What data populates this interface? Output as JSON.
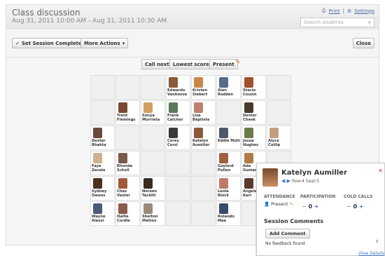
{
  "header": {
    "title": "Class discussion",
    "subtitle": "Aug 31, 2011 10:00 AM - Aug 31, 2011 10:30 AM",
    "print": "Print",
    "settings": "Settings",
    "search_placeholder": "Search students"
  },
  "toolbar": {
    "set_session_completed": "Set Session Completed",
    "more_actions": "More Actions",
    "close": "Close"
  },
  "grid_actions": {
    "call_next": "Call next",
    "lowest_scores": "Lowest scores",
    "present": "Present"
  },
  "seats": [
    {
      "row": 0,
      "col": 3,
      "name": "Edwardo Vanhoose",
      "color": "#8a5a3a"
    },
    {
      "row": 0,
      "col": 4,
      "name": "Kristen Siebert",
      "color": "#c9874a"
    },
    {
      "row": 0,
      "col": 5,
      "name": "Alan Rodden",
      "color": "#5a6a8a"
    },
    {
      "row": 0,
      "col": 6,
      "name": "Stacie Cousin",
      "color": "#a05030"
    },
    {
      "row": 1,
      "col": 1,
      "name": "Trent Flemings",
      "color": "#7a4a30"
    },
    {
      "row": 1,
      "col": 2,
      "name": "Sonya Murrieta",
      "color": "#d0a060"
    },
    {
      "row": 1,
      "col": 3,
      "name": "Frank Catcher",
      "color": "#5a7a5a"
    },
    {
      "row": 1,
      "col": 4,
      "name": "Lisa Baptiste",
      "color": "#c08070"
    },
    {
      "row": 1,
      "col": 6,
      "name": "Dexter Cheek",
      "color": "#4a3a2a"
    },
    {
      "row": 2,
      "col": 0,
      "name": "Dexter Bhakta",
      "color": "#6a4a3a"
    },
    {
      "row": 2,
      "col": 3,
      "name": "Corey Corsi",
      "color": "#3a3a3a"
    },
    {
      "row": 2,
      "col": 4,
      "name": "Katelyn Aumiller",
      "color": "#8a5a3a"
    },
    {
      "row": 2,
      "col": 5,
      "name": "Eddie Mott",
      "color": "#4a5a6a"
    },
    {
      "row": 2,
      "col": 6,
      "name": "Josue Hughes",
      "color": "#6a7a4a"
    },
    {
      "row": 2,
      "col": 7,
      "name": "Alyce Cutlip",
      "color": "#c0a080"
    },
    {
      "row": 3,
      "col": 0,
      "name": "Faye Zavala",
      "color": "#d0b090"
    },
    {
      "row": 3,
      "col": 1,
      "name": "Rhonda Scholl",
      "color": "#7a5a4a"
    },
    {
      "row": 3,
      "col": 5,
      "name": "Gaylord Pullen",
      "color": "#a06040"
    },
    {
      "row": 3,
      "col": 6,
      "name": "Ada Guman",
      "color": "#b07a4a"
    },
    {
      "row": 4,
      "col": 0,
      "name": "Sydney Owens",
      "color": "#4a3020"
    },
    {
      "row": 4,
      "col": 1,
      "name": "Chas Vester",
      "color": "#a05a3a"
    },
    {
      "row": 4,
      "col": 2,
      "name": "Noreen Tackitt",
      "color": "#3a2a20"
    },
    {
      "row": 4,
      "col": 5,
      "name": "Leola Block",
      "color": "#c07a6a"
    },
    {
      "row": 4,
      "col": 6,
      "name": "Angela Karr",
      "color": "#5a3a2a"
    },
    {
      "row": 5,
      "col": 0,
      "name": "Wayne Alessi",
      "color": "#4a5a7a"
    },
    {
      "row": 5,
      "col": 1,
      "name": "Hallie Cordle",
      "color": "#8a5a4a"
    },
    {
      "row": 5,
      "col": 2,
      "name": "Shelton Mattox",
      "color": "#9a8a7a"
    },
    {
      "row": 5,
      "col": 5,
      "name": "Rolando Mae",
      "color": "#3a4a6a"
    }
  ],
  "empty_cells": [
    [
      0,
      0
    ],
    [
      0,
      7
    ],
    [
      1,
      0
    ],
    [
      1,
      7
    ],
    [
      2,
      1
    ],
    [
      3,
      2
    ],
    [
      3,
      3
    ],
    [
      3,
      4
    ],
    [
      3,
      7
    ],
    [
      4,
      3
    ],
    [
      4,
      4
    ],
    [
      5,
      3
    ],
    [
      5,
      4
    ],
    [
      5,
      6
    ]
  ],
  "popup": {
    "name": "Katelyn Aumiller",
    "row_seat": "Row:4 Seat:5",
    "attendance_label": "ATTENDANCE",
    "participation_label": "PARTICIPATION",
    "cold_calls_label": "COLD CALLS",
    "attendance_value": "Present",
    "participation_value": "0",
    "cold_calls_value": "0",
    "session_comments": "Session Comments",
    "add_comment": "Add Comment",
    "no_feedback": "No feedback found",
    "view_details": "View Details"
  },
  "colors": {
    "link": "#3b73c6",
    "pencil": "#d17a2a"
  }
}
